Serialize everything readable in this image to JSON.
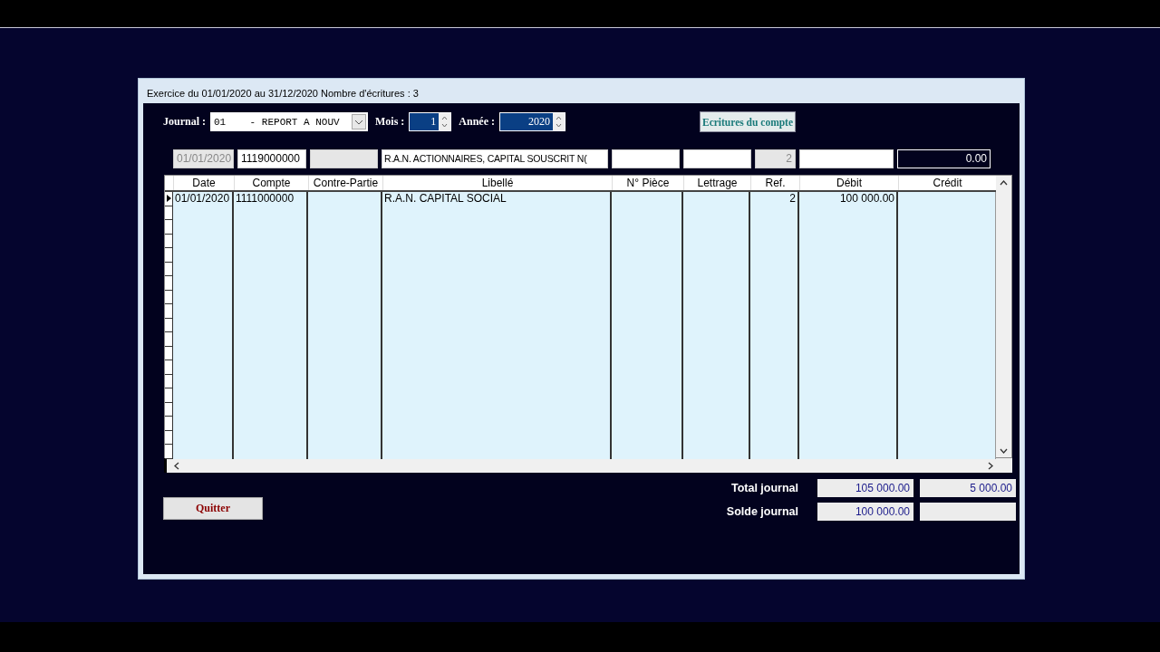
{
  "window": {
    "title": "Exercice du 01/01/2020 au 31/12/2020  Nombre d'écritures : 3"
  },
  "journal": {
    "label": "Journal :",
    "value": "01    - REPORT A NOUV"
  },
  "mois": {
    "label": "Mois :",
    "value": "1"
  },
  "annee": {
    "label": "Année :",
    "value": "2020"
  },
  "ecritures_button": "Ecritures du compte",
  "entry_fields": [
    {
      "value": "01/01/2020",
      "disabled": true,
      "focused": false
    },
    {
      "value": "1119000000",
      "disabled": false,
      "focused": false
    },
    {
      "disabled": true,
      "focused": false
    },
    {
      "value": "R.A.N. ACTIONNAIRES, CAPITAL SOUSCRIT N(",
      "disabled": false,
      "focused": false
    },
    {
      "disabled": false,
      "focused": false
    },
    {
      "disabled": false,
      "focused": false
    },
    {
      "value": "2",
      "disabled": true,
      "focused": false
    },
    {
      "disabled": false,
      "focused": false
    },
    {
      "value": "0.00",
      "disabled": false,
      "focused": true
    }
  ],
  "table": {
    "columns": [
      "Date",
      "Compte",
      "Contre-Partie",
      "Libellé",
      "N° Pièce",
      "Lettrage",
      "Ref.",
      "Débit",
      "Crédit"
    ],
    "rows": [
      {
        "current": true,
        "cells": [
          "01/01/2020",
          "1111000000",
          "",
          "R.A.N. CAPITAL SOCIAL",
          "",
          "",
          "2",
          "100 000.00",
          ""
        ]
      }
    ]
  },
  "quit_button": "Quitter",
  "totals": [
    {
      "label": "Total journal",
      "debit": "105 000.00",
      "credit": "5 000.00"
    },
    {
      "label": "Solde journal",
      "debit": "100 000.00"
    }
  ]
}
